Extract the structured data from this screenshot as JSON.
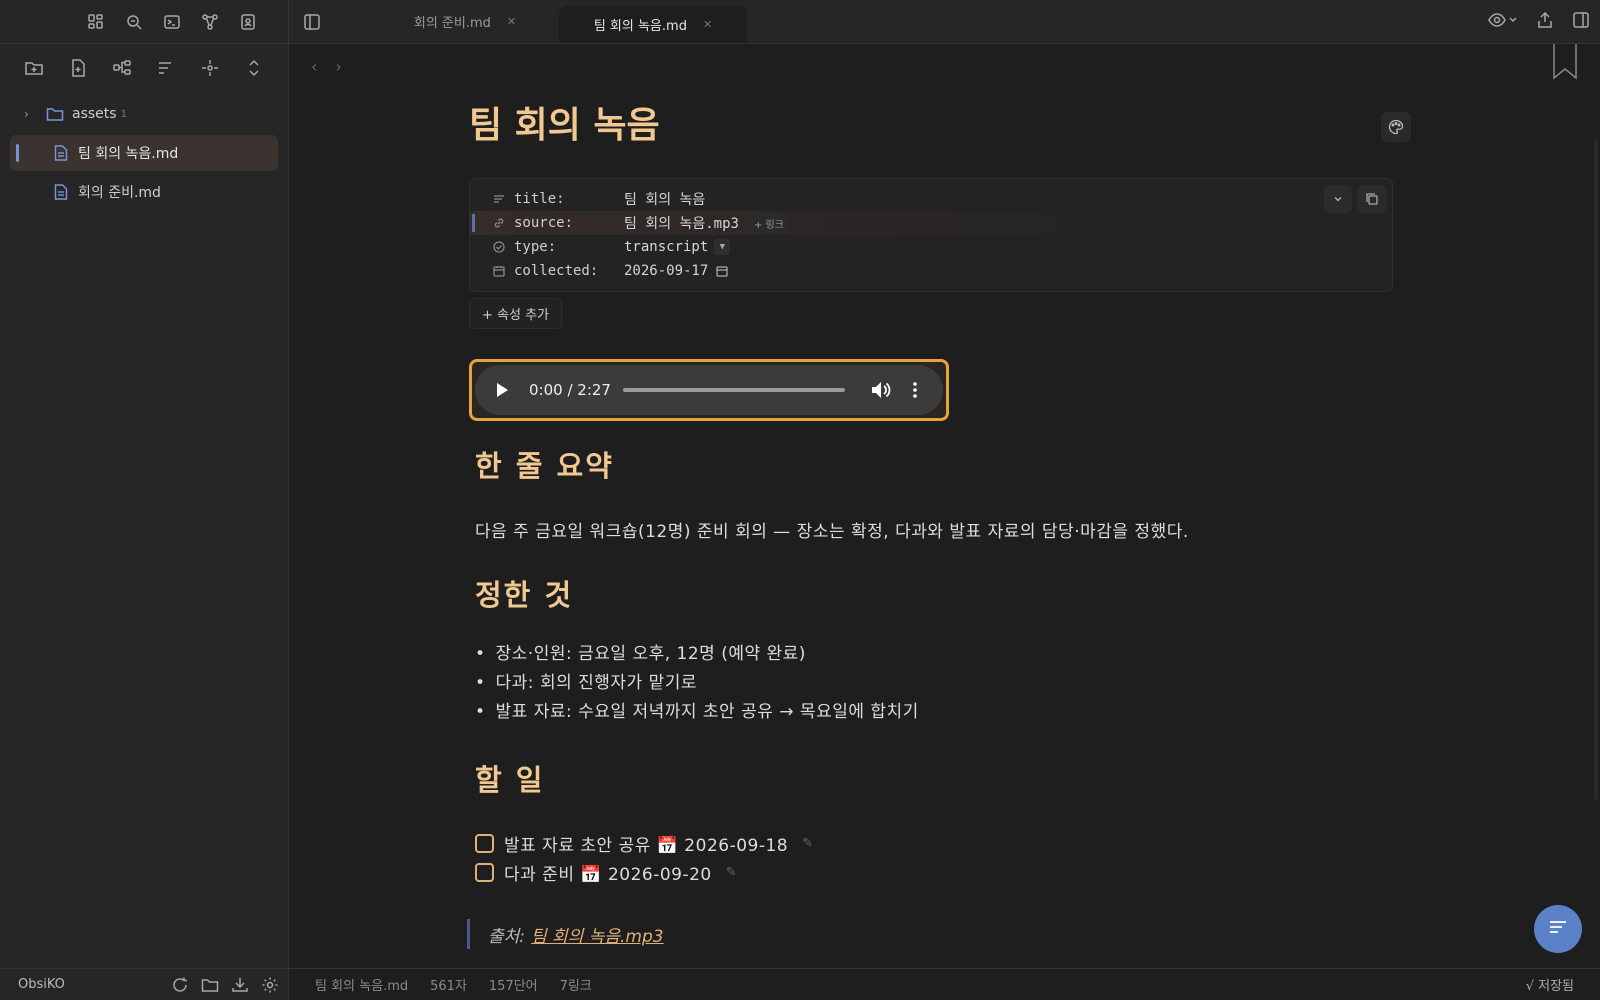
{
  "sidebar": {
    "tree": [
      {
        "type": "folder",
        "name": "assets",
        "count": "1"
      },
      {
        "type": "file",
        "name": "팀 회의 녹음.md",
        "active": true
      },
      {
        "type": "file",
        "name": "회의 준비.md"
      }
    ],
    "vault_name": "ObsiKO"
  },
  "tabs": [
    {
      "label": "회의 준비.md",
      "active": false
    },
    {
      "label": "팀 회의 녹음.md",
      "active": true
    }
  ],
  "document": {
    "title": "팀 회의 녹음",
    "properties": [
      {
        "key": "title:",
        "value": "팀 회의 녹음",
        "icon": "text-lines-icon"
      },
      {
        "key": "source:",
        "value": "팀 회의 녹음.mp3",
        "icon": "link-icon",
        "badge": "+ 링크"
      },
      {
        "key": "type:",
        "value": "transcript",
        "icon": "circle-check-icon"
      },
      {
        "key": "collected:",
        "value": "2026-09-17",
        "icon": "calendar-icon"
      }
    ],
    "add_property_label": "+ 속성 추가",
    "audio": {
      "time": "0:00 / 2:27",
      "progress": 0
    },
    "summary_heading": "한 줄 요약",
    "summary_text": "다음 주 금요일 워크숍(12명) 준비 회의 — 장소는 확정, 다과와 발표 자료의 담당·마감을 정했다.",
    "decided_heading": "정한 것",
    "decided_items": [
      "장소·인원: 금요일 오후, 12명 (예약 완료)",
      "다과: 회의 진행자가 맡기로",
      "발표 자료: 수요일 저녁까지 초안 공유 → 목요일에 합치기"
    ],
    "todo_heading": "할 일",
    "todos": [
      {
        "text": "발표 자료 초안 공유 📅 2026-09-18",
        "done": false
      },
      {
        "text": "다과 준비 📅 2026-09-20",
        "done": false
      }
    ],
    "quote_prefix": "출처:",
    "quote_link": "팀 회의 녹음.mp3"
  },
  "statusbar": {
    "filename": "팀 회의 녹음.md",
    "chars": "561자",
    "words": "157단어",
    "links": "7링크",
    "saved": "√ 저장됨"
  },
  "colors": {
    "accent": "#f0c890",
    "highlight_border": "#e8a23c",
    "fab": "#5b82c9"
  }
}
